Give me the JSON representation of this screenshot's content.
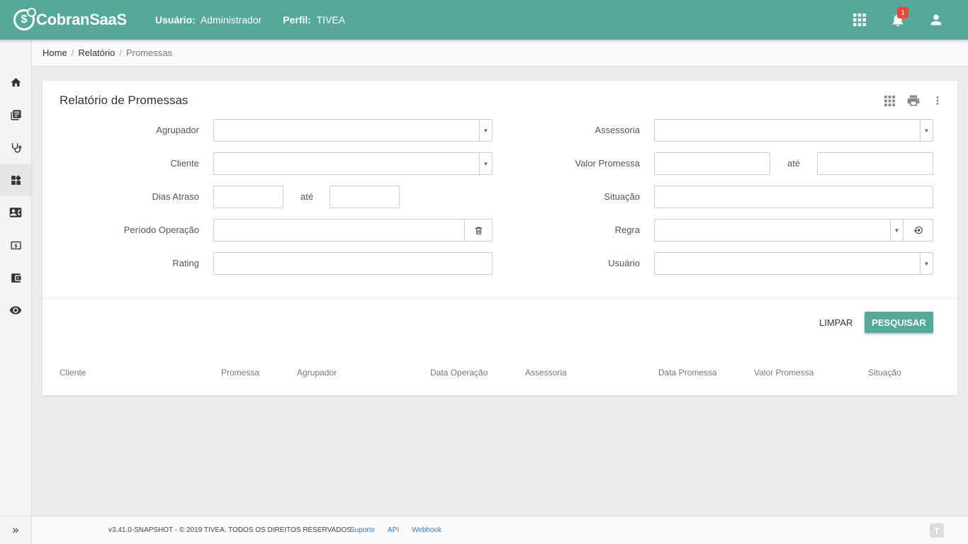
{
  "header": {
    "brand": "CobranSaaS",
    "user_label": "Usuário:",
    "user_value": "Administrador",
    "profile_label": "Perfil:",
    "profile_value": "TIVEA",
    "notification_count": "1"
  },
  "breadcrumb": {
    "home": "Home",
    "relatorio": "Relatório",
    "current": "Promessas"
  },
  "card": {
    "title": "Relatório de Promessas"
  },
  "form": {
    "agrupador": "Agrupador",
    "cliente": "Cliente",
    "dias_atraso": "Dias Atraso",
    "periodo_operacao": "Período Operação",
    "rating": "Rating",
    "assessoria": "Assessoria",
    "valor_promessa": "Valor Promessa",
    "situacao": "Situação",
    "regra": "Regra",
    "usuario": "Usuário",
    "ate": "até"
  },
  "buttons": {
    "limpar": "LIMPAR",
    "pesquisar": "PESQUISAR"
  },
  "table": {
    "columns": [
      "Cliente",
      "Promessa",
      "Agrupador",
      "Data Operação",
      "Assessoria",
      "Data Promessa",
      "Valor Promessa",
      "Situação"
    ]
  },
  "footer": {
    "copyright": "v3.41.0-SNAPSHOT - © 2019 TIVEA. TODOS OS DIREITOS RESERVADOS.",
    "links": [
      "Suporte",
      "API",
      "Webhook"
    ]
  },
  "colors": {
    "primary": "#55a89a",
    "badge": "#f44336"
  }
}
